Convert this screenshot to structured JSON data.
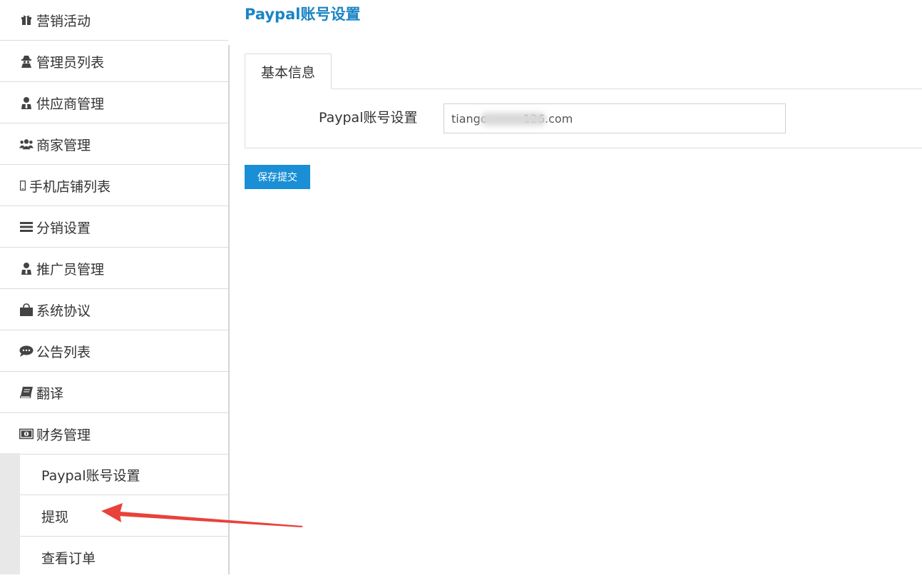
{
  "sidebar": {
    "items": [
      {
        "label": "营销活动",
        "icon": "gift-icon"
      },
      {
        "label": "管理员列表",
        "icon": "user-secret-icon"
      },
      {
        "label": "供应商管理",
        "icon": "user-tie-icon"
      },
      {
        "label": "商家管理",
        "icon": "users-icon"
      },
      {
        "label": "手机店铺列表",
        "icon": "mobile-icon"
      },
      {
        "label": "分销设置",
        "icon": "list-icon"
      },
      {
        "label": "推广员管理",
        "icon": "user-tie-icon"
      },
      {
        "label": "系统协议",
        "icon": "shopping-bag-icon"
      },
      {
        "label": "公告列表",
        "icon": "comment-icon"
      },
      {
        "label": "翻译",
        "icon": "book-icon"
      },
      {
        "label": "财务管理",
        "icon": "money-icon"
      }
    ],
    "sub_items": [
      {
        "label": "Paypal账号设置"
      },
      {
        "label": "提现"
      },
      {
        "label": "查看订单"
      }
    ]
  },
  "main": {
    "title": "Paypal账号设置",
    "tab_label": "基本信息",
    "field_label": "Paypal账号设置",
    "field_value": "tiangc          126.com",
    "submit_label": "保存提交"
  },
  "colors": {
    "accent": "#1a84c4",
    "button": "#1a8fd6",
    "arrow": "#e8423a"
  }
}
